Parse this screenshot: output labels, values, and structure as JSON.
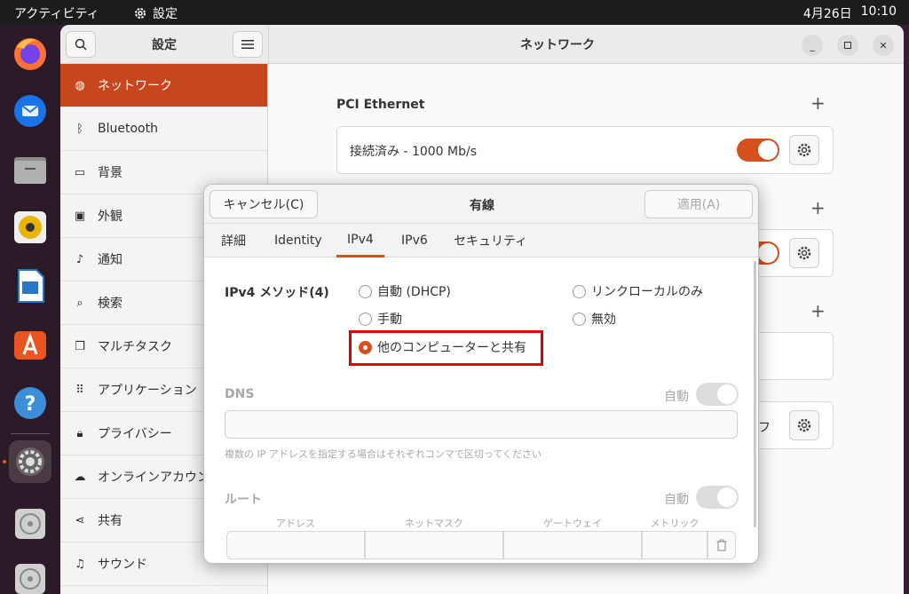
{
  "topbar": {
    "activities": "アクティビティ",
    "app_name": "設定",
    "date": "4月26日",
    "time": "10:10"
  },
  "dock": {
    "items": [
      "firefox-icon",
      "thunderbird-icon",
      "files-icon",
      "rhythmbox-icon",
      "libreoffice-writer-icon",
      "app-center-icon",
      "help-icon",
      "settings-icon",
      "disc-icon",
      "disc-icon"
    ]
  },
  "settings": {
    "sidebar_title": "設定",
    "main_title": "ネットワーク",
    "sidebar_items": [
      {
        "label": "ネットワーク",
        "icon": "network-icon"
      },
      {
        "label": "Bluetooth",
        "icon": "bluetooth-icon"
      },
      {
        "label": "背景",
        "icon": "background-icon"
      },
      {
        "label": "外観",
        "icon": "appearance-icon"
      },
      {
        "label": "通知",
        "icon": "bell-icon"
      },
      {
        "label": "検索",
        "icon": "search-icon"
      },
      {
        "label": "マルチタスク",
        "icon": "multitask-icon"
      },
      {
        "label": "アプリケーション",
        "icon": "apps-icon"
      },
      {
        "label": "プライバシー",
        "icon": "lock-icon"
      },
      {
        "label": "オンラインアカウント",
        "icon": "cloud-icon"
      },
      {
        "label": "共有",
        "icon": "share-icon"
      },
      {
        "label": "サウンド",
        "icon": "music-icon"
      }
    ],
    "pci_ethernet": {
      "title": "PCI Ethernet",
      "status": "接続済み - 1000 Mb/s"
    },
    "partial_label": "オフ"
  },
  "dialog": {
    "title": "有線",
    "cancel": "キャンセル(C)",
    "apply": "適用(A)",
    "tabs": [
      "詳細",
      "Identity",
      "IPv4",
      "IPv6",
      "セキュリティ"
    ],
    "active_tab": "IPv4",
    "method_label": "IPv4 メソッド(4)",
    "methods": {
      "auto": "自動 (DHCP)",
      "link_local": "リンクローカルのみ",
      "manual": "手動",
      "disabled": "無効",
      "shared": "他のコンピューターと共有"
    },
    "selected_method": "他のコンピューターと共有",
    "dns_label": "DNS",
    "auto_label": "自動",
    "dns_hint": "複数の IP アドレスを指定する場合はそれぞれコンマで区切ってください",
    "route_label": "ルート",
    "route_columns": [
      "アドレス",
      "ネットマスク",
      "ゲートウェイ",
      "メトリック"
    ]
  },
  "colors": {
    "accent": "#d4501f",
    "sidebar_active": "#c6471e",
    "highlight_box": "#e00000"
  }
}
